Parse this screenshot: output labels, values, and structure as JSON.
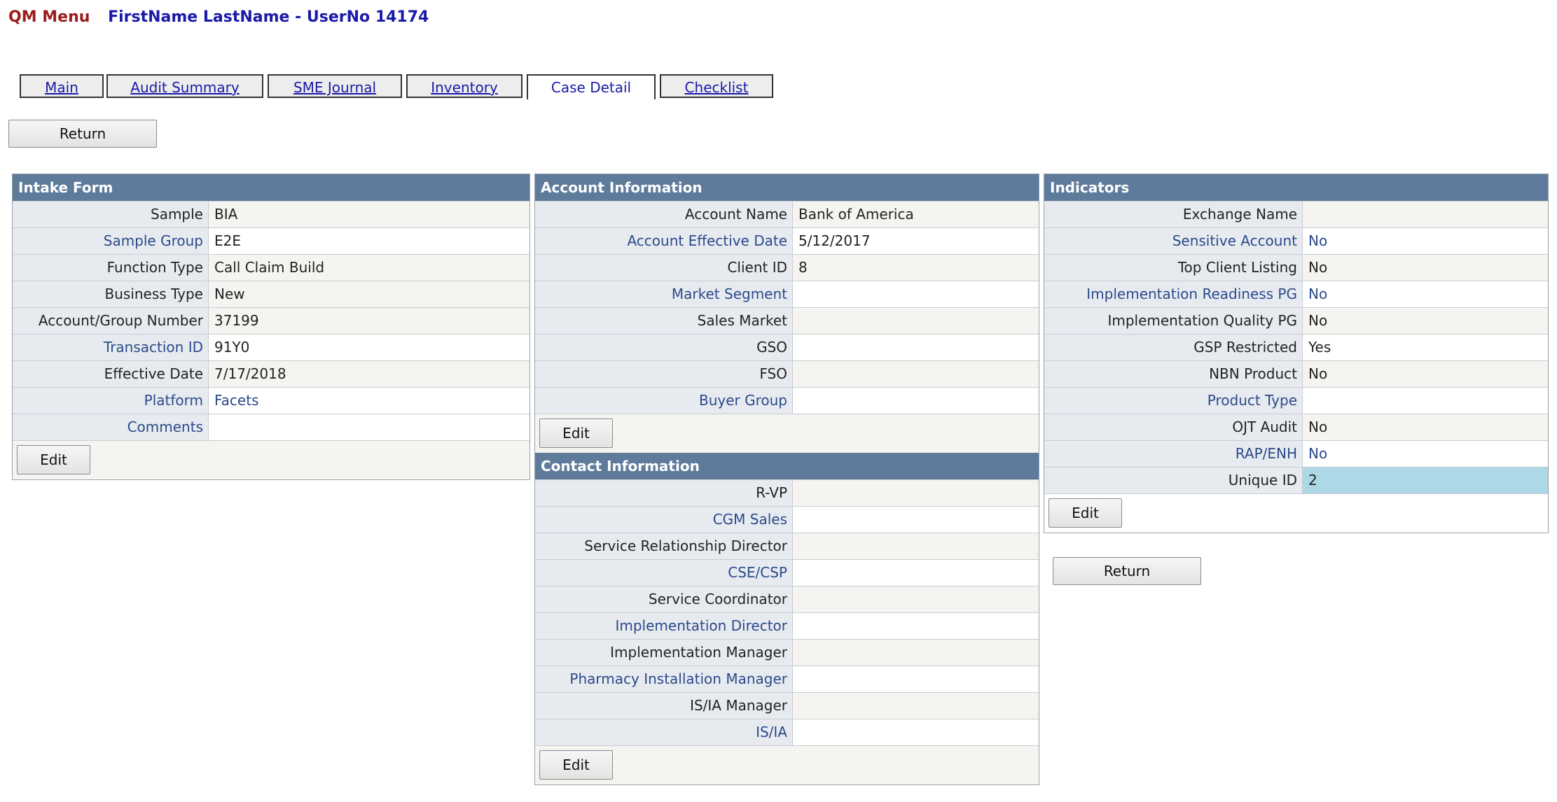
{
  "header": {
    "menu_label": "QM Menu",
    "user_title": "FirstName LastName - UserNo 14174"
  },
  "tabs": [
    {
      "label": "Main"
    },
    {
      "label": "Audit Summary"
    },
    {
      "label": "SME Journal"
    },
    {
      "label": "Inventory"
    },
    {
      "label": "Case Detail",
      "active": true
    },
    {
      "label": "Checklist"
    }
  ],
  "return_label": "Return",
  "edit_label": "Edit",
  "intake": {
    "title": "Intake Form",
    "rows": [
      {
        "label": "Sample",
        "value": "BIA"
      },
      {
        "label": "Sample Group",
        "value": "E2E"
      },
      {
        "label": "Function Type",
        "value": "Call Claim Build"
      },
      {
        "label": "Business Type",
        "value": "New"
      },
      {
        "label": "Account/Group Number",
        "value": "37199"
      },
      {
        "label": "Transaction ID",
        "value": "91Y0"
      },
      {
        "label": "Effective Date",
        "value": "7/17/2018"
      },
      {
        "label": "Platform",
        "value": "Facets"
      },
      {
        "label": "Comments",
        "value": ""
      }
    ]
  },
  "account": {
    "title": "Account Information",
    "rows": [
      {
        "label": "Account Name",
        "value": "Bank of America"
      },
      {
        "label": "Account Effective Date",
        "value": "5/12/2017"
      },
      {
        "label": "Client ID",
        "value": "8"
      },
      {
        "label": "Market Segment",
        "value": ""
      },
      {
        "label": "Sales Market",
        "value": ""
      },
      {
        "label": "GSO",
        "value": ""
      },
      {
        "label": "FSO",
        "value": ""
      },
      {
        "label": "Buyer Group",
        "value": ""
      }
    ]
  },
  "contact": {
    "title": "Contact Information",
    "rows": [
      {
        "label": "R-VP",
        "value": ""
      },
      {
        "label": "CGM Sales",
        "value": ""
      },
      {
        "label": "Service Relationship Director",
        "value": ""
      },
      {
        "label": "CSE/CSP",
        "value": ""
      },
      {
        "label": "Service Coordinator",
        "value": ""
      },
      {
        "label": "Implementation Director",
        "value": ""
      },
      {
        "label": "Implementation Manager",
        "value": ""
      },
      {
        "label": "Pharmacy Installation Manager",
        "value": ""
      },
      {
        "label": "IS/IA Manager",
        "value": ""
      },
      {
        "label": "IS/IA",
        "value": ""
      }
    ]
  },
  "indicators": {
    "title": "Indicators",
    "rows": [
      {
        "label": "Exchange Name",
        "value": ""
      },
      {
        "label": "Sensitive Account",
        "value": "No"
      },
      {
        "label": "Top Client Listing",
        "value": "No"
      },
      {
        "label": "Implementation Readiness PG",
        "value": "No"
      },
      {
        "label": "Implementation Quality PG",
        "value": "No"
      },
      {
        "label": "GSP Restricted",
        "value": "Yes"
      },
      {
        "label": "NBN Product",
        "value": "No"
      },
      {
        "label": "Product Type",
        "value": ""
      },
      {
        "label": "OJT Audit",
        "value": "No"
      },
      {
        "label": "RAP/ENH",
        "value": "No"
      },
      {
        "label": "Unique ID",
        "value": "2"
      }
    ],
    "highlight_color": "#add8e6"
  },
  "colors": {
    "header_bg": "#5f7b9b",
    "menu_red": "#9b1c1c",
    "title_blue": "#1a1aa8"
  }
}
